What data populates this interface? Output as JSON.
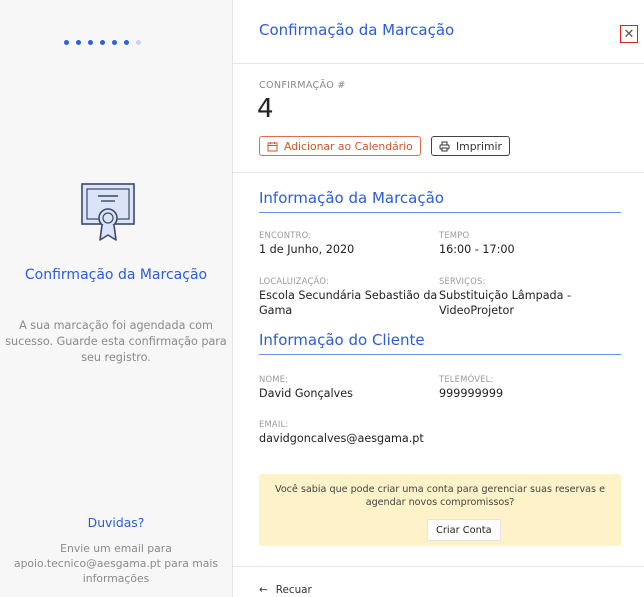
{
  "sidebar": {
    "title": "Confirmação da Marcação",
    "description": "A sua marcação foi agendada com sucesso. Guarde esta confirmação para seu registro.",
    "help_title": "Duvidas?",
    "help_text": "Envie um email para apoio.tecnico@aesgama.pt para mais informações",
    "progress": {
      "total_steps": 7,
      "completed_steps": 6
    },
    "icon": "certificate-icon",
    "accent_color": "#2c5bdc"
  },
  "header": {
    "title": "Confirmação da Marcação",
    "close_icon": "close-icon"
  },
  "confirmation": {
    "label": "CONFIRMAÇÃO #",
    "number": "4",
    "add_calendar_label": "Adicionar ao Calendário",
    "print_label": "Imprimir"
  },
  "booking": {
    "section_title": "Informação da Marcação",
    "encounter_label": "ENCONTRO:",
    "encounter_value": "1 de Junho, 2020",
    "time_label": "TEMPO",
    "time_value": "16:00 - 17:00",
    "location_label": "LOCALUIZAÇÃO:",
    "location_value": "Escola Secundária Sebastião da Gama",
    "services_label": "SERVIÇOS:",
    "services_value": "Substituição Lâmpada - VideoProjetor"
  },
  "client": {
    "section_title": "Informação do Cliente",
    "name_label": "NOME:",
    "name_value": "David Gonçalves",
    "phone_label": "TELEMÓVEL:",
    "phone_value": "999999999",
    "email_label": "EMAIL:",
    "email_value": "davidgoncalves@aesgama.pt"
  },
  "notice": {
    "text": "Você sabia que pode criar uma conta para gerenciar suas reservas e agendar novos compromissos?",
    "create_account_label": "Criar Conta",
    "background": "#fdf2c8"
  },
  "footer": {
    "back_label": "Recuar",
    "back_icon": "arrow-left-icon"
  }
}
